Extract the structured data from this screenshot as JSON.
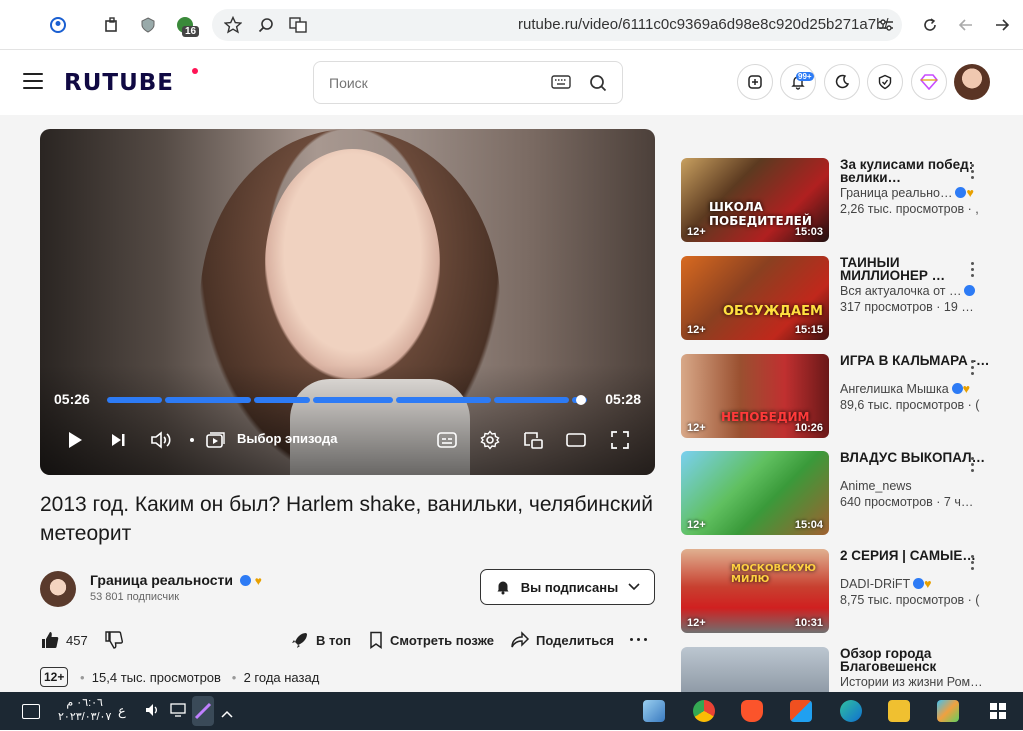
{
  "browser": {
    "url": "rutube.ru/video/6111c0c9369a6d98e8c920d25b271a7b/",
    "extension_badge": "16"
  },
  "header": {
    "logo": "RUTUBE",
    "search_placeholder": "Поиск",
    "notif_count": "99+"
  },
  "player": {
    "current_time": "05:26",
    "total_time": "05:28",
    "episode_label": "Выбор эпизода",
    "progress": 0.99
  },
  "video": {
    "title": "2013 год. Каким он был? Harlem shake, ванильки, челябинский метеорит",
    "channel": "Граница реальности",
    "subscribers": "53 801 подписчик",
    "subscribe_label": "Вы подписаны",
    "likes": "457",
    "top_label": "В топ",
    "watch_later_label": "Смотреть позже",
    "share_label": "Поделиться",
    "age": "12+",
    "views": "15,4 тыс. просмотров",
    "ago": "2 года назад"
  },
  "recommendations": [
    {
      "title": "За кулисами побед: велики…",
      "channel": "Граница реально…",
      "views": "2,26 тыс. просмотров · ,",
      "age": "12+",
      "duration": "15:03",
      "caption": "ШКОЛА ПОБЕДИТЕЛЕЙ"
    },
    {
      "title": "ТАИНЫИ МИЛЛИОНЕР …",
      "channel": "Вся актуалочка от …",
      "views": "317 просмотров · 19 …",
      "age": "12+",
      "duration": "15:15",
      "caption": "ОБСУЖДАЕМ"
    },
    {
      "title": "ИГРА В КАЛЬМАРА -…",
      "channel": "Ангелишка Мышка",
      "views": "89,6 тыс. просмотров · (",
      "age": "12+",
      "duration": "10:26",
      "caption": "НЕПОБЕДИМ"
    },
    {
      "title": "ВЛАДУС ВЫКОПАЛ…",
      "channel": "Anime_news",
      "views": "640 просмотров · 7 ч…",
      "age": "12+",
      "duration": "15:04",
      "caption": ""
    },
    {
      "title": "2 СЕРИЯ | САМЫЕ…",
      "channel": "DADI-DRiFT",
      "views": "8,75 тыс. просмотров · (",
      "age": "12+",
      "duration": "10:31",
      "caption": "МОСКОВСКУЮ МИЛЮ"
    },
    {
      "title": "Обзор города Благовешенск",
      "channel": "Истории из жизни Ром…",
      "views": "",
      "age": "",
      "duration": "",
      "caption": ""
    }
  ],
  "taskbar": {
    "time": "٠٦:٠٦ م",
    "date": "٢٠٢٣/٠٣/٠٧",
    "lang": "ع"
  }
}
